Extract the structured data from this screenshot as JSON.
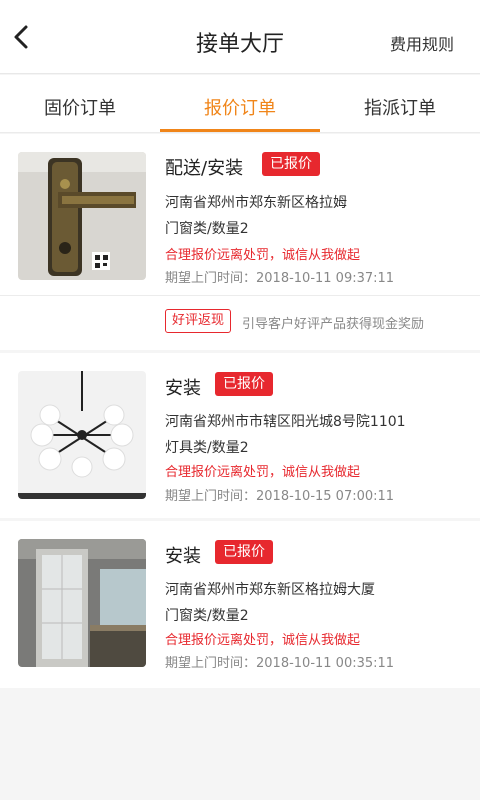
{
  "header": {
    "title": "接单大厅",
    "rules_label": "费用规则",
    "back_icon": "chevron-left-icon"
  },
  "tabs": [
    {
      "label": "固价订单",
      "active": false
    },
    {
      "label": "报价订单",
      "active": true
    },
    {
      "label": "指派订单",
      "active": false
    }
  ],
  "orders": [
    {
      "service": "配送/安装",
      "badge": "已报价",
      "address": "河南省郑州市郑东新区格拉姆",
      "category": "门窗类/数量2",
      "warning": "合理报价远离处罚，诚信从我做起",
      "time": "期望上门时间：2018-10-11 09:37:11",
      "promo_tag": "好评返现",
      "promo_text": "引导客户好评产品获得现金奖励"
    },
    {
      "service": "安装",
      "badge": "已报价",
      "address": "河南省郑州市市辖区阳光城8号院1101",
      "category": "灯具类/数量2",
      "warning": "合理报价远离处罚，诚信从我做起",
      "time": "期望上门时间：2018-10-15 07:00:11"
    },
    {
      "service": "安装",
      "badge": "已报价",
      "address": "河南省郑州市郑东新区格拉姆大厦",
      "category": "门窗类/数量2",
      "warning": "合理报价远离处罚，诚信从我做起",
      "time": "期望上门时间：2018-10-11 00:35:11"
    }
  ],
  "colors": {
    "accent": "#f08519",
    "badge": "#e7282e"
  }
}
